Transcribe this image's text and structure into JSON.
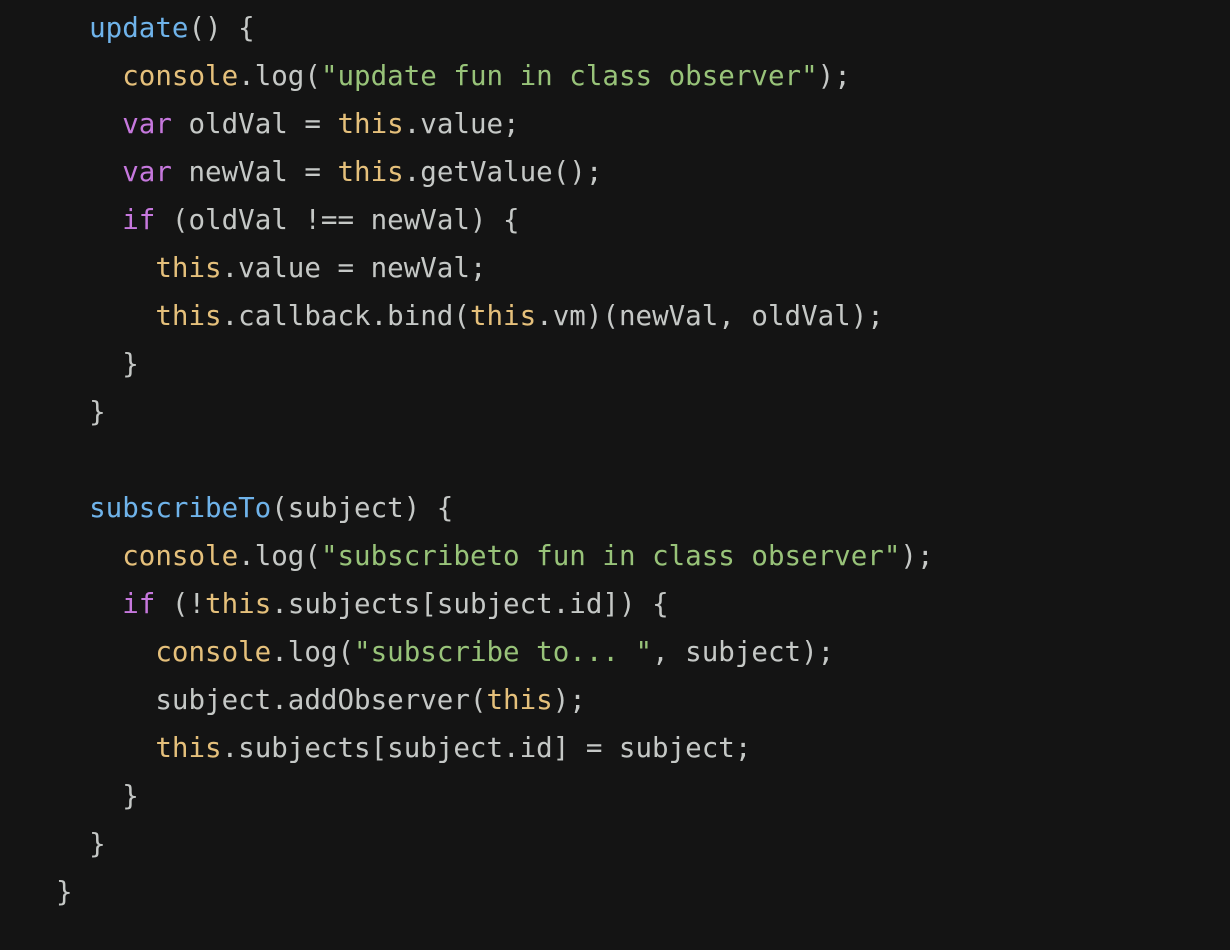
{
  "colors": {
    "background": "#141414",
    "plain": "#c5c8c6",
    "function": "#6fb3ea",
    "builtin": "#e5c07b",
    "keyword": "#c678dd",
    "string": "#98c379"
  },
  "code": {
    "language": "javascript",
    "lines": [
      [
        {
          "t": "func",
          "v": "  update"
        },
        {
          "t": "plain",
          "v": "() {"
        }
      ],
      [
        {
          "t": "plain",
          "v": "    "
        },
        {
          "t": "builtin",
          "v": "console"
        },
        {
          "t": "plain",
          "v": ".log("
        },
        {
          "t": "string",
          "v": "\"update fun in class observer\""
        },
        {
          "t": "plain",
          "v": ");"
        }
      ],
      [
        {
          "t": "plain",
          "v": "    "
        },
        {
          "t": "keyword",
          "v": "var"
        },
        {
          "t": "plain",
          "v": " oldVal = "
        },
        {
          "t": "builtin",
          "v": "this"
        },
        {
          "t": "plain",
          "v": ".value;"
        }
      ],
      [
        {
          "t": "plain",
          "v": "    "
        },
        {
          "t": "keyword",
          "v": "var"
        },
        {
          "t": "plain",
          "v": " newVal = "
        },
        {
          "t": "builtin",
          "v": "this"
        },
        {
          "t": "plain",
          "v": ".getValue();"
        }
      ],
      [
        {
          "t": "plain",
          "v": "    "
        },
        {
          "t": "keyword",
          "v": "if"
        },
        {
          "t": "plain",
          "v": " (oldVal !== newVal) {"
        }
      ],
      [
        {
          "t": "plain",
          "v": "      "
        },
        {
          "t": "builtin",
          "v": "this"
        },
        {
          "t": "plain",
          "v": ".value = newVal;"
        }
      ],
      [
        {
          "t": "plain",
          "v": "      "
        },
        {
          "t": "builtin",
          "v": "this"
        },
        {
          "t": "plain",
          "v": ".callback.bind("
        },
        {
          "t": "builtin",
          "v": "this"
        },
        {
          "t": "plain",
          "v": ".vm)(newVal, oldVal);"
        }
      ],
      [
        {
          "t": "plain",
          "v": "    }"
        }
      ],
      [
        {
          "t": "plain",
          "v": "  }"
        }
      ],
      [],
      [
        {
          "t": "func",
          "v": "  subscribeTo"
        },
        {
          "t": "plain",
          "v": "(subject) {"
        }
      ],
      [
        {
          "t": "plain",
          "v": "    "
        },
        {
          "t": "builtin",
          "v": "console"
        },
        {
          "t": "plain",
          "v": ".log("
        },
        {
          "t": "string",
          "v": "\"subscribeto fun in class observer\""
        },
        {
          "t": "plain",
          "v": ");"
        }
      ],
      [
        {
          "t": "plain",
          "v": "    "
        },
        {
          "t": "keyword",
          "v": "if"
        },
        {
          "t": "plain",
          "v": " (!"
        },
        {
          "t": "builtin",
          "v": "this"
        },
        {
          "t": "plain",
          "v": ".subjects[subject.id]) {"
        }
      ],
      [
        {
          "t": "plain",
          "v": "      "
        },
        {
          "t": "builtin",
          "v": "console"
        },
        {
          "t": "plain",
          "v": ".log("
        },
        {
          "t": "string",
          "v": "\"subscribe to... \""
        },
        {
          "t": "plain",
          "v": ", subject);"
        }
      ],
      [
        {
          "t": "plain",
          "v": "      subject.addObserver("
        },
        {
          "t": "builtin",
          "v": "this"
        },
        {
          "t": "plain",
          "v": ");"
        }
      ],
      [
        {
          "t": "plain",
          "v": "      "
        },
        {
          "t": "builtin",
          "v": "this"
        },
        {
          "t": "plain",
          "v": ".subjects[subject.id] = subject;"
        }
      ],
      [
        {
          "t": "plain",
          "v": "    }"
        }
      ],
      [
        {
          "t": "plain",
          "v": "  }"
        }
      ],
      [
        {
          "t": "plain",
          "v": "}"
        }
      ]
    ]
  }
}
